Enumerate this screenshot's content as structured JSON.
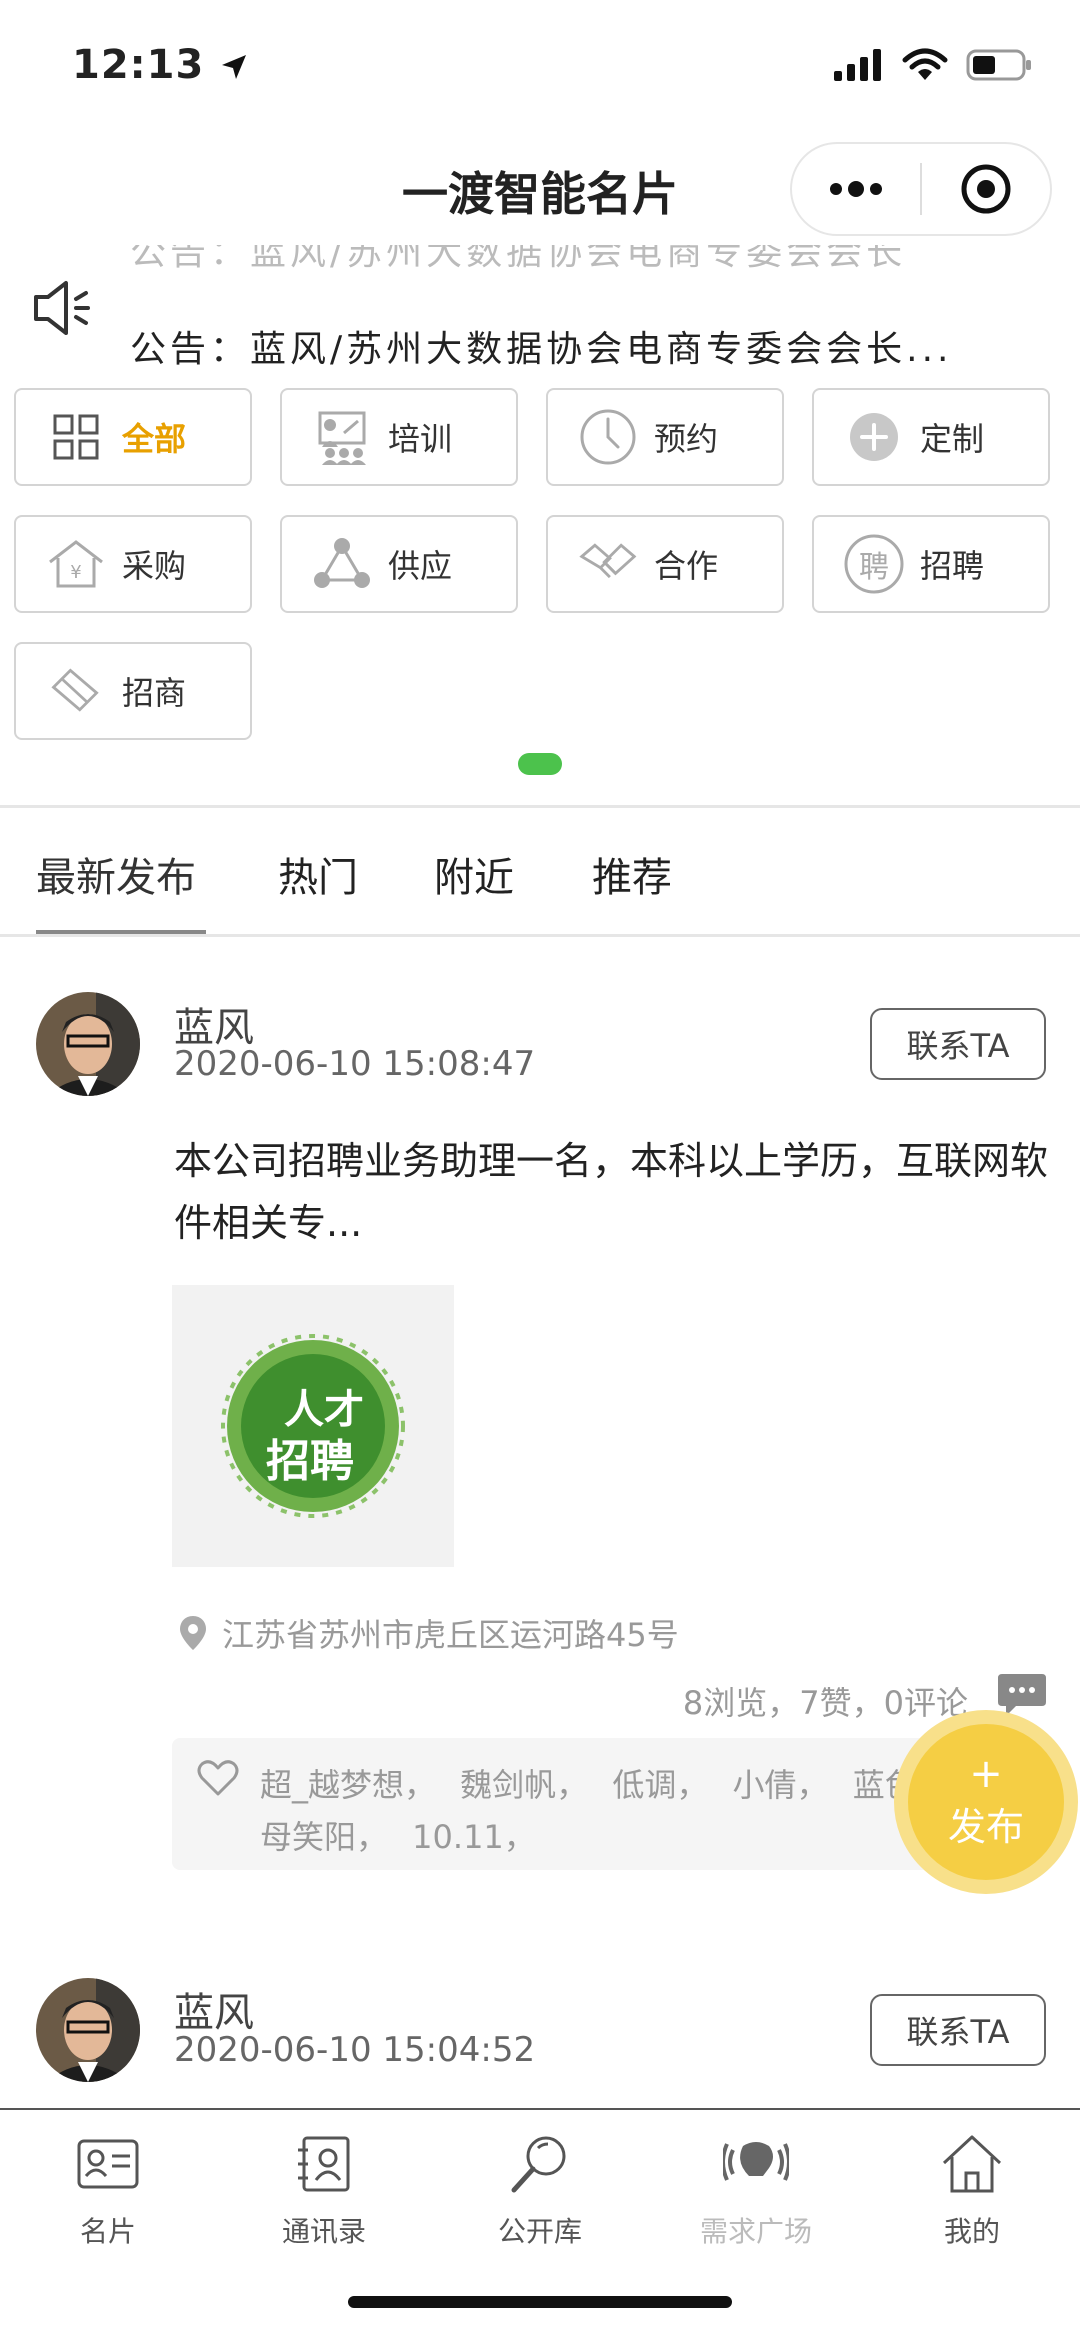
{
  "status_bar": {
    "time": "12:13"
  },
  "header": {
    "title": "一渡智能名片"
  },
  "notice": {
    "previous_text": "公告：蓝风/苏州大数据协会电商专委会会长",
    "text": "公告：蓝风/苏州大数据协会电商专委会会长..."
  },
  "categories": [
    {
      "label": "全部",
      "icon": "grid-icon",
      "active": true
    },
    {
      "label": "培训",
      "icon": "training-icon"
    },
    {
      "label": "预约",
      "icon": "clock-icon"
    },
    {
      "label": "定制",
      "icon": "plus-circle-icon"
    },
    {
      "label": "采购",
      "icon": "purchase-house-icon"
    },
    {
      "label": "供应",
      "icon": "supply-network-icon"
    },
    {
      "label": "合作",
      "icon": "handshake-icon"
    },
    {
      "label": "招聘",
      "icon": "recruit-icon",
      "glyph": "聘"
    },
    {
      "label": "招商",
      "icon": "business-handshake-icon"
    }
  ],
  "tabs": [
    {
      "label": "最新发布",
      "active": true
    },
    {
      "label": "热门"
    },
    {
      "label": "附近"
    },
    {
      "label": "推荐"
    }
  ],
  "posts": [
    {
      "name": "蓝风",
      "time": "2020-06-10 15:08:47",
      "contact_label": "联系TA",
      "content": "本公司招聘业务助理一名，本科以上学历，互联网软件相关专...",
      "image_text": {
        "line1": "人才",
        "line2": "招聘"
      },
      "location": "江苏省苏州市虎丘区运河路45号",
      "stats": "8浏览，7赞，0评论",
      "likes_line1": "超_越梦想， 魏剑帆， 低调， 小倩， 蓝色妖",
      "likes_line2": "母笑阳， 10.11，"
    },
    {
      "name": "蓝风",
      "time": "2020-06-10 15:04:52",
      "contact_label": "联系TA"
    }
  ],
  "fab": {
    "plus": "+",
    "label": "发布"
  },
  "bottom_nav": [
    {
      "label": "名片",
      "icon": "card-icon"
    },
    {
      "label": "通讯录",
      "icon": "contacts-icon"
    },
    {
      "label": "公开库",
      "icon": "search-icon"
    },
    {
      "label": "需求广场",
      "icon": "broadcast-icon",
      "dim": true
    },
    {
      "label": "我的",
      "icon": "home-icon"
    }
  ],
  "colors": {
    "accent": "#e8a000",
    "fab": "#f5ce44",
    "dot": "#4cc24c"
  }
}
